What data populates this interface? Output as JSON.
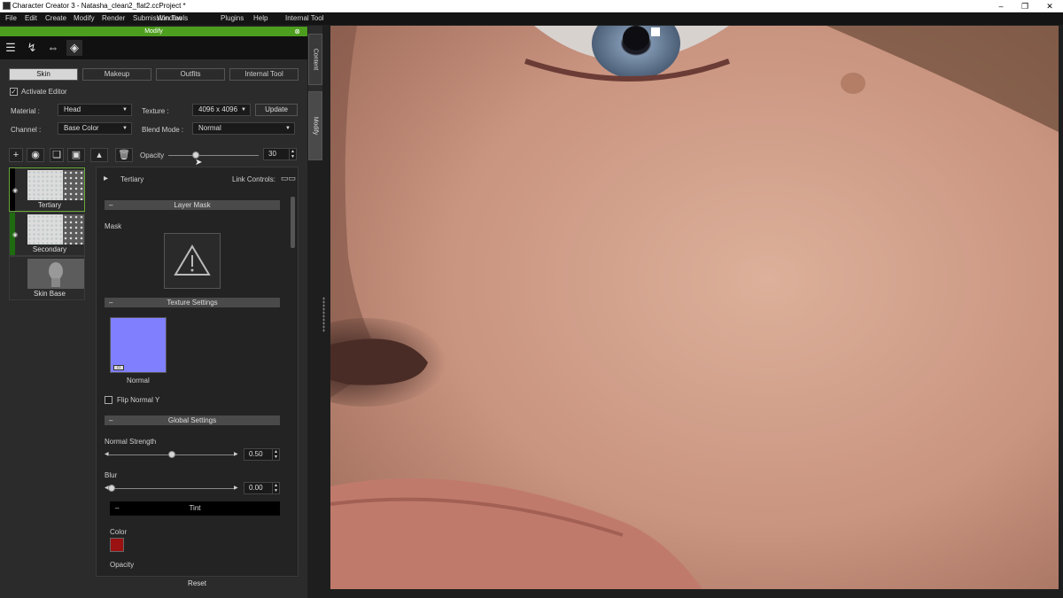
{
  "window": {
    "title": "Character Creator 3 - Natasha_clean2_flat2.ccProject *"
  },
  "menu": [
    "File",
    "Edit",
    "Create",
    "Modify",
    "Render",
    "Submission Tools",
    "Window",
    "Plugins",
    "Help",
    "Internal Tool"
  ],
  "panel": {
    "title": "Modify"
  },
  "tabs": [
    "Skin",
    "Makeup",
    "Outfits",
    "Internal Tool"
  ],
  "editor": {
    "activate_label": "Activate Editor",
    "material_label": "Material :",
    "material_value": "Head",
    "texture_label": "Texture :",
    "texture_value": "4096 x 4096",
    "update_label": "Update",
    "channel_label": "Channel :",
    "channel_value": "Base Color",
    "blend_label": "Blend Mode :",
    "blend_value": "Normal",
    "opacity_label": "Opacity",
    "opacity_value": "30",
    "opacity_fraction": 0.3
  },
  "layers": [
    {
      "name": "Tertiary"
    },
    {
      "name": "Secondary"
    },
    {
      "name": "Skin Base"
    }
  ],
  "props": {
    "layer_name": "Tertiary",
    "link_controls": "Link Controls:",
    "layer_mask": "Layer Mask",
    "mask_label": "Mask",
    "texture_settings": "Texture Settings",
    "normal_label": "Normal",
    "flip_label": "Flip Normal Y",
    "global_settings": "Global Settings",
    "normal_strength_label": "Normal Strength",
    "normal_strength_value": "0.50",
    "normal_strength_fraction": 0.5,
    "blur_label": "Blur",
    "blur_value": "0.00",
    "blur_fraction": 0.0,
    "tint": "Tint",
    "color_label": "Color",
    "tint_opacity_label": "Opacity",
    "reset_label": "Reset"
  },
  "side_tabs": [
    "Content",
    "Modify"
  ],
  "colors": {
    "accent": "#4d9d1e",
    "normal_swatch": "#8080ff",
    "tint_color": "#9b1010"
  }
}
